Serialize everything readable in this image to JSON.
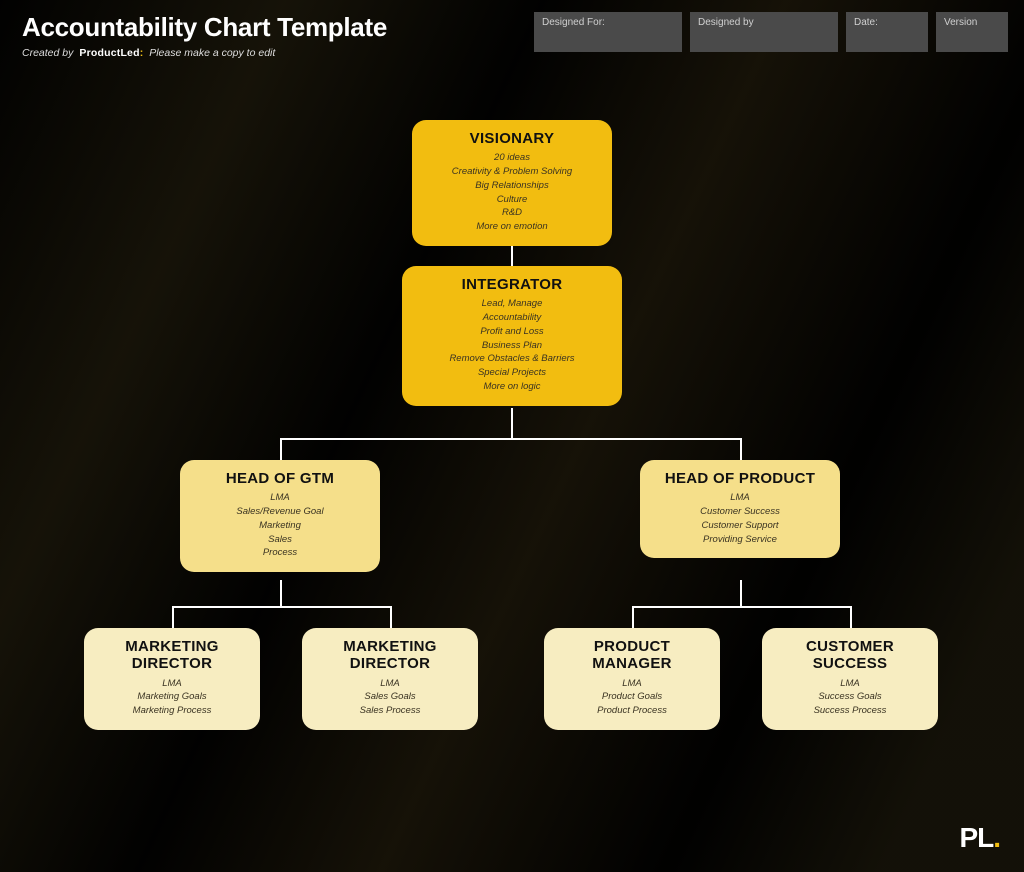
{
  "header": {
    "title": "Accountability Chart Template",
    "created_by_prefix": "Created by",
    "brand": "ProductLed",
    "copy_note": "Please make a copy to edit"
  },
  "meta": {
    "designed_for_label": "Designed For:",
    "designed_by_label": "Designed by",
    "date_label": "Date:",
    "version_label": "Version"
  },
  "nodes": {
    "visionary": {
      "role": "VISIONARY",
      "items": [
        "20 ideas",
        "Creativity & Problem Solving",
        "Big Relationships",
        "Culture",
        "R&D",
        "More on emotion"
      ]
    },
    "integrator": {
      "role": "INTEGRATOR",
      "items": [
        "Lead, Manage",
        "Accountability",
        "Profit and Loss",
        "Business Plan",
        "Remove Obstacles & Barriers",
        "Special Projects",
        "More on logic"
      ]
    },
    "gtm": {
      "role": "HEAD OF GTM",
      "items": [
        "LMA",
        "Sales/Revenue Goal",
        "Marketing",
        "Sales",
        "Process"
      ]
    },
    "product": {
      "role": "HEAD OF PRODUCT",
      "items": [
        "LMA",
        "Customer Success",
        "Customer Support",
        "Providing Service"
      ]
    },
    "mkt1": {
      "role": "MARKETING DIRECTOR",
      "items": [
        "LMA",
        "Marketing Goals",
        "Marketing Process"
      ]
    },
    "mkt2": {
      "role": "MARKETING DIRECTOR",
      "items": [
        "LMA",
        "Sales Goals",
        "Sales Process"
      ]
    },
    "pm": {
      "role": "PRODUCT MANAGER",
      "items": [
        "LMA",
        "Product Goals",
        "Product Process"
      ]
    },
    "cs": {
      "role": "CUSTOMER SUCCESS",
      "items": [
        "LMA",
        "Success Goals",
        "Success Process"
      ]
    }
  }
}
